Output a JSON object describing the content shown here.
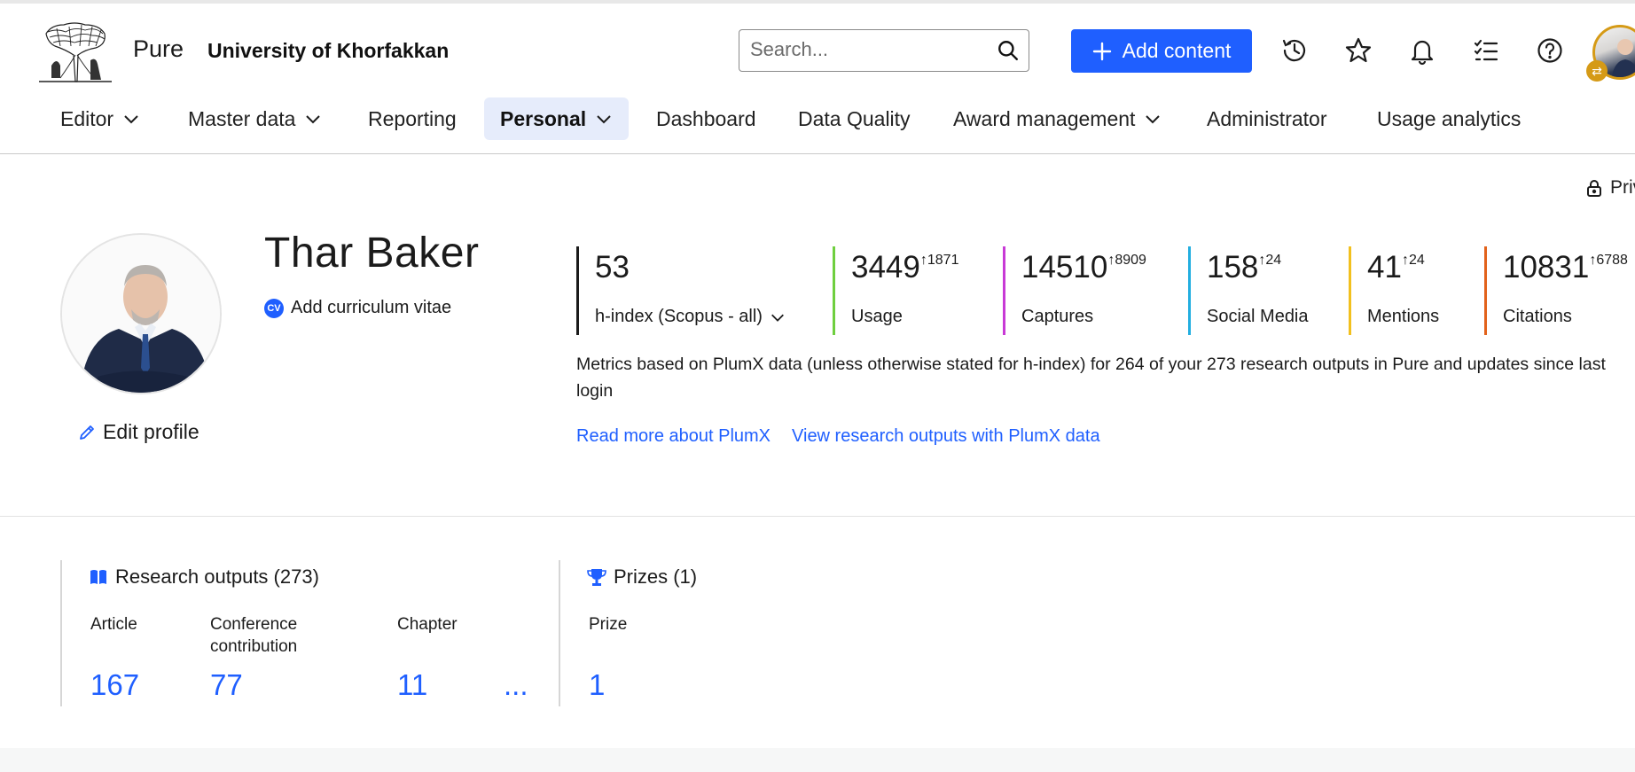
{
  "header": {
    "app_name": "Pure",
    "org_name": "University of Khorfakkan",
    "search_placeholder": "Search...",
    "add_content_label": "Add content",
    "icons": [
      "history-icon",
      "star-icon",
      "bell-icon",
      "checklist-icon",
      "help-icon"
    ]
  },
  "nav": [
    {
      "label": "Editor"
    },
    {
      "label": "Master data"
    },
    {
      "label": "Reporting"
    },
    {
      "label": "Personal"
    },
    {
      "label": "Dashboard"
    },
    {
      "label": "Data Quality"
    },
    {
      "label": "Award management"
    },
    {
      "label": "Administrator"
    },
    {
      "label": "Usage analytics"
    }
  ],
  "privacy_label": "Priv",
  "profile": {
    "name": "Thar Baker",
    "cv_badge": "CV",
    "add_cv_label": "Add curriculum vitae",
    "edit_label": "Edit profile"
  },
  "metrics": [
    {
      "value": "53",
      "delta": "",
      "label": "h-index (Scopus - all)",
      "color": "#1b1b1b"
    },
    {
      "value": "3449",
      "delta": "1871",
      "label": "Usage",
      "color": "#6fcf3f"
    },
    {
      "value": "14510",
      "delta": "8909",
      "label": "Captures",
      "color": "#c83ad6"
    },
    {
      "value": "158",
      "delta": "24",
      "label": "Social Media",
      "color": "#22aee0"
    },
    {
      "value": "41",
      "delta": "24",
      "label": "Mentions",
      "color": "#f2c01e"
    },
    {
      "value": "10831",
      "delta": "6788",
      "label": "Citations",
      "color": "#e2621b"
    }
  ],
  "metrics_note": "Metrics based on PlumX data (unless otherwise stated for h-index) for 264 of your 273 research outputs in Pure and updates since last login",
  "links": {
    "read_more": "Read more about PlumX",
    "view_outputs": "View research outputs with PlumX data"
  },
  "research_outputs": {
    "title": "Research outputs (273)",
    "categories": [
      {
        "label": "Article",
        "count": "167"
      },
      {
        "label": "Conference contribution",
        "count": "77"
      },
      {
        "label": "Chapter",
        "count": "11"
      }
    ],
    "more": "..."
  },
  "prizes": {
    "title": "Prizes (1)",
    "categories": [
      {
        "label": "Prize",
        "count": "1"
      }
    ]
  }
}
